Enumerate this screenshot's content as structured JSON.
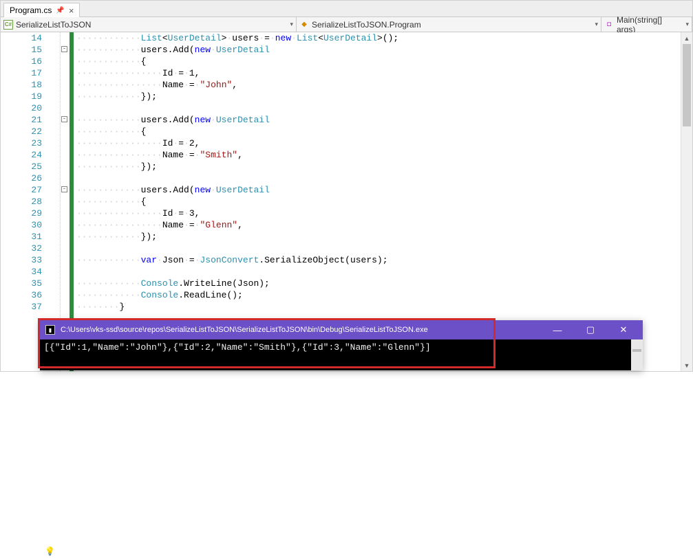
{
  "tab": {
    "title": "Program.cs"
  },
  "nav": {
    "namespace": "SerializeListToJSON",
    "class": "SerializeListToJSON.Program",
    "method": "Main(string[] args)"
  },
  "lines": [
    {
      "n": "14",
      "fold": "",
      "t": [
        [
          "ws",
          "············"
        ],
        [
          "type",
          "List"
        ],
        [
          "plain",
          "<"
        ],
        [
          "type",
          "UserDetail"
        ],
        [
          "plain",
          ">"
        ],
        [
          "ws",
          "·"
        ],
        [
          "plain",
          "users"
        ],
        [
          "ws",
          "·"
        ],
        [
          "plain",
          "="
        ],
        [
          "ws",
          "·"
        ],
        [
          "kw",
          "new"
        ],
        [
          "ws",
          "·"
        ],
        [
          "type",
          "List"
        ],
        [
          "plain",
          "<"
        ],
        [
          "type",
          "UserDetail"
        ],
        [
          "plain",
          ">();"
        ]
      ]
    },
    {
      "n": "15",
      "fold": "-",
      "t": [
        [
          "ws",
          "············"
        ],
        [
          "plain",
          "users.Add("
        ],
        [
          "kw",
          "new"
        ],
        [
          "ws",
          "·"
        ],
        [
          "type",
          "UserDetail"
        ]
      ]
    },
    {
      "n": "16",
      "fold": "",
      "t": [
        [
          "ws",
          "············"
        ],
        [
          "plain",
          "{"
        ]
      ]
    },
    {
      "n": "17",
      "fold": "",
      "t": [
        [
          "ws",
          "················"
        ],
        [
          "plain",
          "Id"
        ],
        [
          "ws",
          "·"
        ],
        [
          "plain",
          "="
        ],
        [
          "ws",
          "·"
        ],
        [
          "plain",
          "1,"
        ]
      ]
    },
    {
      "n": "18",
      "fold": "",
      "t": [
        [
          "ws",
          "················"
        ],
        [
          "plain",
          "Name"
        ],
        [
          "ws",
          "·"
        ],
        [
          "plain",
          "="
        ],
        [
          "ws",
          "·"
        ],
        [
          "str",
          "\"John\""
        ],
        [
          "plain",
          ","
        ]
      ]
    },
    {
      "n": "19",
      "fold": "",
      "t": [
        [
          "ws",
          "············"
        ],
        [
          "plain",
          "});"
        ]
      ]
    },
    {
      "n": "20",
      "fold": "",
      "t": []
    },
    {
      "n": "21",
      "fold": "-",
      "t": [
        [
          "ws",
          "············"
        ],
        [
          "plain",
          "users.Add("
        ],
        [
          "kw",
          "new"
        ],
        [
          "ws",
          "·"
        ],
        [
          "type",
          "UserDetail"
        ]
      ]
    },
    {
      "n": "22",
      "fold": "",
      "t": [
        [
          "ws",
          "············"
        ],
        [
          "plain",
          "{"
        ]
      ]
    },
    {
      "n": "23",
      "fold": "",
      "t": [
        [
          "ws",
          "················"
        ],
        [
          "plain",
          "Id"
        ],
        [
          "ws",
          "·"
        ],
        [
          "plain",
          "="
        ],
        [
          "ws",
          "·"
        ],
        [
          "plain",
          "2,"
        ]
      ]
    },
    {
      "n": "24",
      "fold": "",
      "t": [
        [
          "ws",
          "················"
        ],
        [
          "plain",
          "Name"
        ],
        [
          "ws",
          "·"
        ],
        [
          "plain",
          "="
        ],
        [
          "ws",
          "·"
        ],
        [
          "str",
          "\"Smith\""
        ],
        [
          "plain",
          ","
        ]
      ]
    },
    {
      "n": "25",
      "fold": "",
      "t": [
        [
          "ws",
          "············"
        ],
        [
          "plain",
          "});"
        ]
      ]
    },
    {
      "n": "26",
      "fold": "",
      "t": []
    },
    {
      "n": "27",
      "fold": "-",
      "t": [
        [
          "ws",
          "············"
        ],
        [
          "plain",
          "users.Add("
        ],
        [
          "kw",
          "new"
        ],
        [
          "ws",
          "·"
        ],
        [
          "type",
          "UserDetail"
        ]
      ]
    },
    {
      "n": "28",
      "fold": "",
      "t": [
        [
          "ws",
          "············"
        ],
        [
          "plain",
          "{"
        ]
      ]
    },
    {
      "n": "29",
      "fold": "",
      "t": [
        [
          "ws",
          "················"
        ],
        [
          "plain",
          "Id"
        ],
        [
          "ws",
          "·"
        ],
        [
          "plain",
          "="
        ],
        [
          "ws",
          "·"
        ],
        [
          "plain",
          "3,"
        ]
      ]
    },
    {
      "n": "30",
      "fold": "",
      "t": [
        [
          "ws",
          "················"
        ],
        [
          "plain",
          "Name"
        ],
        [
          "ws",
          "·"
        ],
        [
          "plain",
          "="
        ],
        [
          "ws",
          "·"
        ],
        [
          "str",
          "\"Glenn\""
        ],
        [
          "plain",
          ","
        ]
      ]
    },
    {
      "n": "31",
      "fold": "",
      "t": [
        [
          "ws",
          "············"
        ],
        [
          "plain",
          "});"
        ]
      ]
    },
    {
      "n": "32",
      "fold": "",
      "t": []
    },
    {
      "n": "33",
      "fold": "",
      "t": [
        [
          "ws",
          "············"
        ],
        [
          "kw",
          "var"
        ],
        [
          "ws",
          "·"
        ],
        [
          "plain",
          "Json"
        ],
        [
          "ws",
          "·"
        ],
        [
          "plain",
          "="
        ],
        [
          "ws",
          "·"
        ],
        [
          "type",
          "JsonConvert"
        ],
        [
          "plain",
          ".SerializeObject(users);"
        ]
      ]
    },
    {
      "n": "34",
      "fold": "",
      "t": []
    },
    {
      "n": "35",
      "fold": "",
      "t": [
        [
          "ws",
          "············"
        ],
        [
          "type",
          "Console"
        ],
        [
          "plain",
          ".WriteLine(Json);"
        ]
      ]
    },
    {
      "n": "36",
      "fold": "",
      "bulb": true,
      "t": [
        [
          "ws",
          "············"
        ],
        [
          "type",
          "Console"
        ],
        [
          "plain",
          ".ReadLine();"
        ]
      ]
    },
    {
      "n": "37",
      "fold": "",
      "t": [
        [
          "ws",
          "········"
        ],
        [
          "plain",
          "}"
        ]
      ]
    }
  ],
  "console": {
    "title": "C:\\Users\\vks-ssd\\source\\repos\\SerializeListToJSON\\SerializeListToJSON\\bin\\Debug\\SerializeListToJSON.exe",
    "output": "[{\"Id\":1,\"Name\":\"John\"},{\"Id\":2,\"Name\":\"Smith\"},{\"Id\":3,\"Name\":\"Glenn\"}]"
  }
}
